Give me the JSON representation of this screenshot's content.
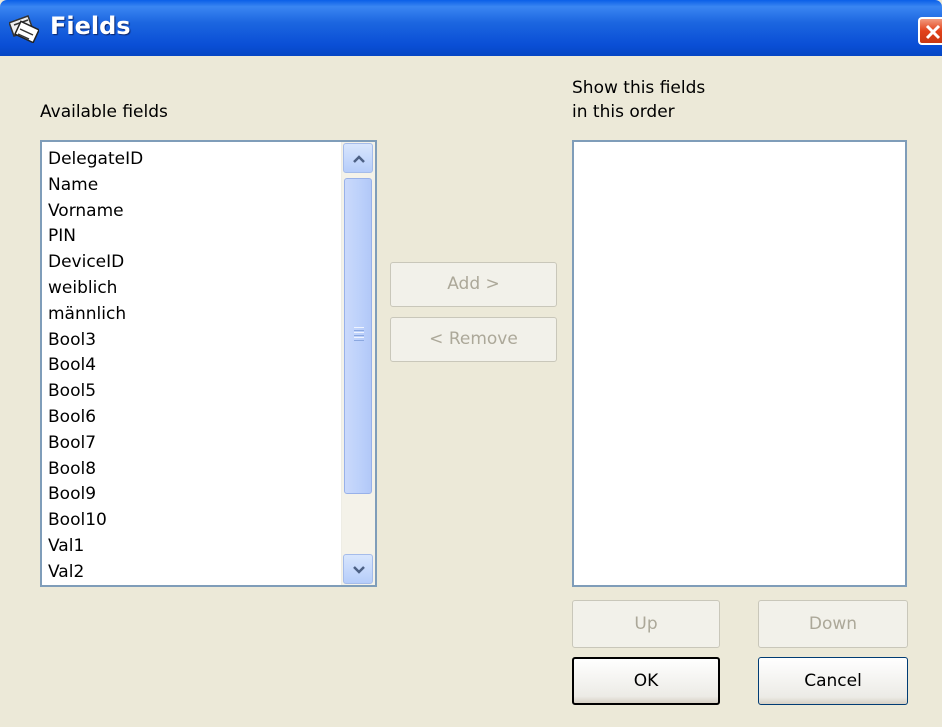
{
  "window": {
    "title": "Fields"
  },
  "available": {
    "label": "Available fields",
    "items": [
      "DelegateID",
      "Name",
      "Vorname",
      "PIN",
      "DeviceID",
      "weiblich",
      "männlich",
      "Bool3",
      "Bool4",
      "Bool5",
      "Bool6",
      "Bool7",
      "Bool8",
      "Bool9",
      "Bool10",
      "Val1",
      "Val2"
    ]
  },
  "selected": {
    "label_line1": "Show this fields",
    "label_line2": "in this order",
    "items": []
  },
  "buttons": {
    "add": "Add >",
    "remove": "< Remove",
    "up": "Up",
    "down": "Down",
    "ok": "OK",
    "cancel": "Cancel"
  },
  "colors": {
    "titlebar": "#0a4fd6",
    "dialog_bg": "#ece9d8",
    "list_border": "#7f9db9",
    "disabled_text": "#aca899"
  },
  "icons": {
    "title": "fields-app-icon",
    "close": "close-icon"
  }
}
